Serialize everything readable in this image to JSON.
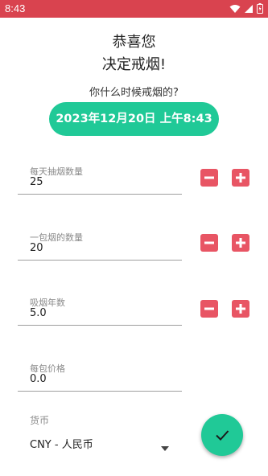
{
  "status_bar": {
    "time": "8:43",
    "background": "#d9434f",
    "icons": [
      "wifi-icon",
      "signal-icon",
      "battery-charging-icon"
    ]
  },
  "header": {
    "line1": "恭喜您",
    "line2": "决定戒烟!"
  },
  "quit_date": {
    "question": "你什么时候戒烟的?",
    "button_label": "2023年12月20日 上午8:43"
  },
  "fields": [
    {
      "label": "每天抽烟数量",
      "value": "25",
      "stepper": true
    },
    {
      "label": "一包烟的数量",
      "value": "20",
      "stepper": true
    },
    {
      "label": "吸烟年数",
      "value": "5.0",
      "stepper": true
    },
    {
      "label": "每包价格",
      "value": "0.0",
      "stepper": false
    }
  ],
  "currency": {
    "label": "货币",
    "selected": "CNY - 人民币"
  },
  "fab": {
    "icon": "check-icon"
  },
  "colors": {
    "accent": "#20c997",
    "stepper": "#e85564",
    "status_bar": "#d9434f"
  }
}
